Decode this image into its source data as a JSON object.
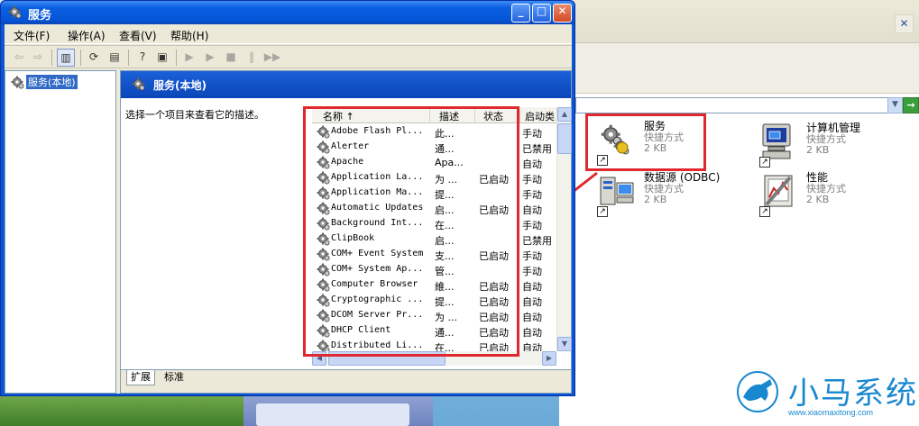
{
  "window": {
    "title": "服务",
    "min_label": "_",
    "max_label": "□",
    "close_label": "✕"
  },
  "menubar": {
    "items": [
      {
        "label": "文件(F)"
      },
      {
        "label": "操作(A)"
      },
      {
        "label": "查看(V)"
      },
      {
        "label": "帮助(H)"
      }
    ]
  },
  "toolbar": {
    "buttons": [
      "back-icon",
      "forward-icon",
      "show-hide-tree-icon",
      "refresh-icon",
      "export-list-icon",
      "help-icon",
      "properties-icon",
      "start-icon",
      "start-alt-icon",
      "stop-icon",
      "pause-icon",
      "restart-icon"
    ]
  },
  "tree": {
    "root_label": "服务(本地)"
  },
  "pane": {
    "header_title": "服务(本地)",
    "description": "选择一个项目来查看它的描述。"
  },
  "services_list": {
    "columns": [
      "名称 ↑",
      "描述",
      "状态",
      "启动类"
    ],
    "rows": [
      {
        "name": "Adobe Flash Pl...",
        "desc": "此...",
        "status": "",
        "startup": "手动"
      },
      {
        "name": "Alerter",
        "desc": "通...",
        "status": "",
        "startup": "已禁用"
      },
      {
        "name": "Apache",
        "desc": "Apa...",
        "status": "",
        "startup": "自动"
      },
      {
        "name": "Application La...",
        "desc": "为 ...",
        "status": "已启动",
        "startup": "手动"
      },
      {
        "name": "Application Ma...",
        "desc": "提...",
        "status": "",
        "startup": "手动"
      },
      {
        "name": "Automatic Updates",
        "desc": "启...",
        "status": "已启动",
        "startup": "自动"
      },
      {
        "name": "Background Int...",
        "desc": "在...",
        "status": "",
        "startup": "手动"
      },
      {
        "name": "ClipBook",
        "desc": "启...",
        "status": "",
        "startup": "已禁用"
      },
      {
        "name": "COM+ Event System",
        "desc": "支...",
        "status": "已启动",
        "startup": "手动"
      },
      {
        "name": "COM+ System Ap...",
        "desc": "管...",
        "status": "",
        "startup": "手动"
      },
      {
        "name": "Computer Browser",
        "desc": "維...",
        "status": "已启动",
        "startup": "自动"
      },
      {
        "name": "Cryptographic ...",
        "desc": "提...",
        "status": "已启动",
        "startup": "自动"
      },
      {
        "name": "DCOM Server Pr...",
        "desc": "为 ...",
        "status": "已启动",
        "startup": "自动"
      },
      {
        "name": "DHCP Client",
        "desc": "通...",
        "status": "已启动",
        "startup": "自动"
      },
      {
        "name": "Distributed Li...",
        "desc": "在...",
        "status": "已启动",
        "startup": "自动"
      }
    ]
  },
  "tabs": [
    {
      "label": "扩展"
    },
    {
      "label": "标准"
    }
  ],
  "explorer": {
    "close_label": "✕",
    "go_label": "→",
    "items": [
      {
        "title": "服务",
        "subtitle": "快捷方式",
        "size": "2 KB",
        "icon": "services-icon"
      },
      {
        "title": "计算机管理",
        "subtitle": "快捷方式",
        "size": "2 KB",
        "icon": "computer-management-icon"
      },
      {
        "title": "数据源 (ODBC)",
        "subtitle": "快捷方式",
        "size": "2 KB",
        "icon": "odbc-icon"
      },
      {
        "title": "性能",
        "subtitle": "快捷方式",
        "size": "2 KB",
        "icon": "performance-icon"
      }
    ]
  },
  "watermark": {
    "brand": "小马系统",
    "url": "www.xiaomaxitong.com"
  },
  "colors": {
    "highlight_border": "#e0282e",
    "title_blue": "#0a57d5",
    "selection": "#316ac5"
  }
}
